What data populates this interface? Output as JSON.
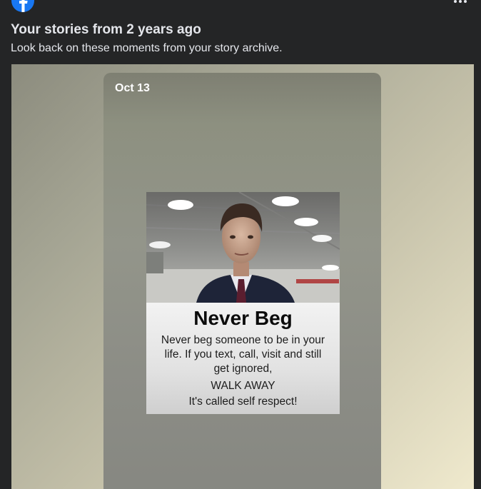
{
  "header": {
    "logo_icon": "facebook-logo-icon",
    "more_icon": "more-horizontal-icon",
    "title": "Your stories from 2 years ago",
    "subtitle": "Look back on these moments from your story archive."
  },
  "story": {
    "date": "Oct 13",
    "poster": {
      "headline": "Never Beg",
      "body": "Never beg someone to be in your life. If you text, call, visit and still get ignored,",
      "walk_away": "WALK AWAY",
      "respect": "It's called self respect!"
    }
  },
  "colors": {
    "background": "#242526",
    "text": "#e4e6eb",
    "brand": "#1877f2"
  }
}
